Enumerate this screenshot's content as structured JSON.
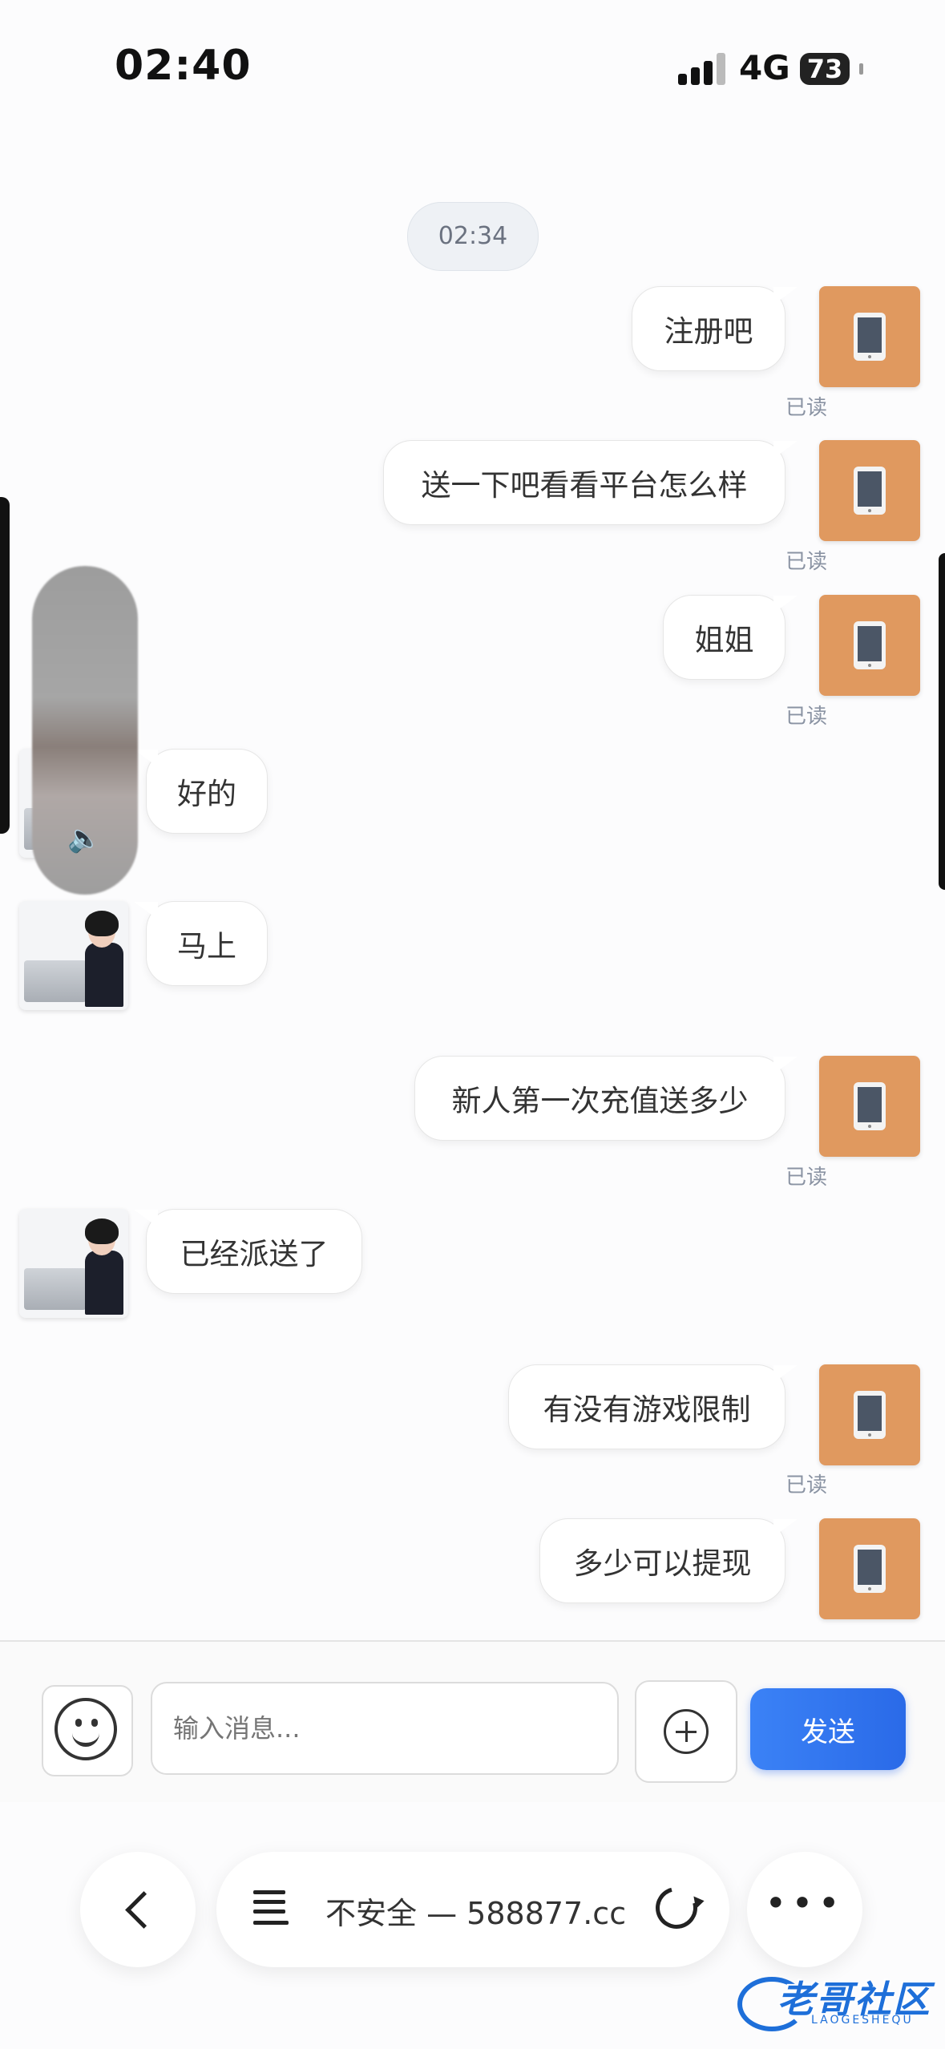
{
  "status_bar": {
    "time": "02:40",
    "network": "4G",
    "battery": "73"
  },
  "chat": {
    "timestamp": "02:34",
    "messages": [
      {
        "side": "right",
        "text": "注册吧",
        "read": "已读"
      },
      {
        "side": "right",
        "text": "送一下吧看看平台怎么样",
        "read": "已读"
      },
      {
        "side": "right",
        "text": "姐姐",
        "read": "已读"
      },
      {
        "side": "left",
        "text": "好的"
      },
      {
        "side": "left",
        "text": "马上"
      },
      {
        "side": "right",
        "text": "新人第一次充值送多少",
        "read": "已读"
      },
      {
        "side": "left",
        "text": "已经派送了"
      },
      {
        "side": "right",
        "text": "有没有游戏限制",
        "read": "已读"
      },
      {
        "side": "right",
        "text": "多少可以提现"
      }
    ]
  },
  "composer": {
    "placeholder": "输入消息...",
    "send_label": "发送"
  },
  "browser": {
    "url": "不安全 — 588877.cc"
  },
  "watermark": {
    "text": "老哥社区",
    "sub": "LAOGESHEQU"
  },
  "colors": {
    "user_avatar": "#e0995f",
    "send_button": "#2f74ee"
  }
}
